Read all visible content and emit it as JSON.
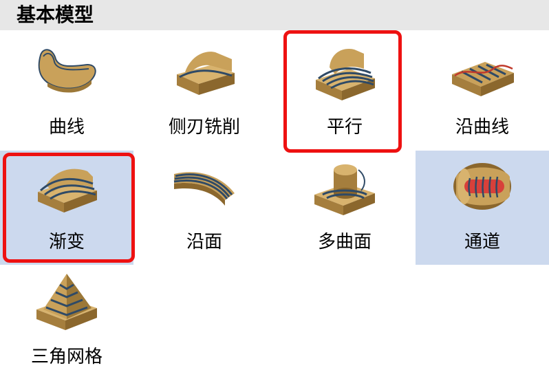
{
  "header": {
    "title": "基本模型"
  },
  "tiles": [
    {
      "label": "曲线",
      "icon": "curve-model-icon",
      "selected": false,
      "highlighted": false
    },
    {
      "label": "侧刃铣削",
      "icon": "side-milling-icon",
      "selected": false,
      "highlighted": false
    },
    {
      "label": "平行",
      "icon": "parallel-icon",
      "selected": false,
      "highlighted": true
    },
    {
      "label": "沿曲线",
      "icon": "along-curve-icon",
      "selected": false,
      "highlighted": false
    },
    {
      "label": "渐变",
      "icon": "morph-icon",
      "selected": true,
      "highlighted": true
    },
    {
      "label": "沿面",
      "icon": "along-surface-icon",
      "selected": false,
      "highlighted": false
    },
    {
      "label": "多曲面",
      "icon": "multi-surface-icon",
      "selected": false,
      "highlighted": false
    },
    {
      "label": "通道",
      "icon": "channel-icon",
      "selected": true,
      "highlighted": false
    },
    {
      "label": "三角网格",
      "icon": "triangle-mesh-icon",
      "selected": false,
      "highlighted": false
    }
  ],
  "colors": {
    "header_bg": "#e7e7e7",
    "selected_bg": "#ccd9ee",
    "highlight_border": "#ee1111",
    "model_gold": "#c9a15a",
    "model_groove": "#2f4a66",
    "channel_red": "#d8403a"
  }
}
